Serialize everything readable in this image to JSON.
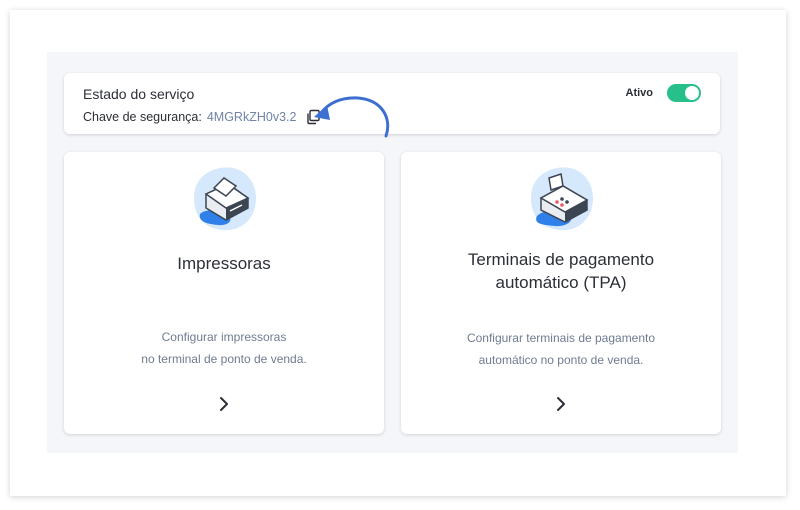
{
  "status": {
    "title": "Estado do serviço",
    "key_label": "Chave de segurança:",
    "key_value": "4MGRkZH0v3.2",
    "toggle_label": "Ativo",
    "toggle_on": true
  },
  "cards": [
    {
      "title_line1": "Impressoras",
      "title_line2": "",
      "desc_line1": "Configurar impressoras",
      "desc_line2": "no terminal de ponto de venda.",
      "icon": "printer-icon"
    },
    {
      "title_line1": "Terminais de pagamento",
      "title_line2": "automático (TPA)",
      "desc_line1": "Configurar terminais de pagamento",
      "desc_line2": "automático no ponto de venda.",
      "icon": "payment-terminal-icon"
    }
  ],
  "colors": {
    "accent": "#27c08a",
    "key_text": "#6f84a6",
    "annotation_arrow": "#3d6fd1",
    "icon_blob": "#d6e8fb"
  }
}
